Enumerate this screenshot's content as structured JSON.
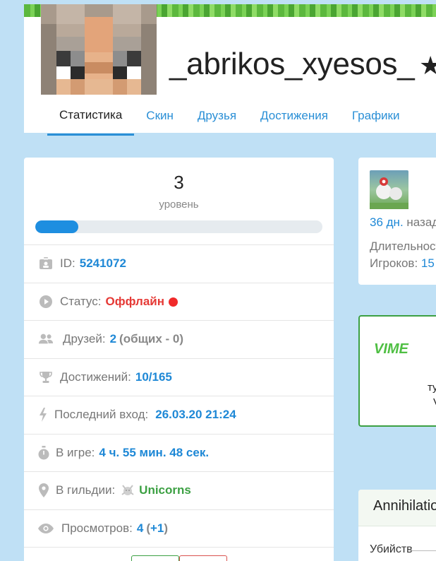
{
  "profile": {
    "username": "_abrikos_xyesos_",
    "star_icon": "star-icon"
  },
  "tabs": [
    {
      "label": "Статистика",
      "active": true
    },
    {
      "label": "Скин"
    },
    {
      "label": "Друзья"
    },
    {
      "label": "Достижения"
    },
    {
      "label": "Графики"
    }
  ],
  "stats": {
    "level": "3",
    "level_label": "уровень",
    "level_progress_percent": 15,
    "rows": {
      "id": {
        "label": "ID:",
        "value": "5241072",
        "icon": "id-card-icon"
      },
      "status": {
        "label": "Статус:",
        "value": "Оффлайн",
        "icon": "play-circle-icon"
      },
      "friends": {
        "label": "Друзей:",
        "value": "2",
        "extra": "(общих - 0)",
        "icon": "users-icon"
      },
      "achievements": {
        "label": "Достижений:",
        "value": "10/165",
        "icon": "trophy-icon"
      },
      "last_login": {
        "label": "Последний вход:",
        "value": "26.03.20 21:24",
        "icon": "bolt-icon"
      },
      "playtime": {
        "label": "В игре:",
        "value": "4 ч. 55 мин. 48 сек.",
        "icon": "stopwatch-icon"
      },
      "guild": {
        "label": "В гильдии:",
        "value": "Unicorns",
        "icon": "map-marker-icon"
      },
      "views": {
        "label": "Просмотров:",
        "value": "4",
        "open": "(",
        "extra": "+1",
        "close": ")",
        "icon": "eye-icon"
      }
    }
  },
  "last_game": {
    "ago_value": "36 дн.",
    "ago_suffix": "назад",
    "duration_label": "Длительность",
    "players_label": "Игроков:",
    "players_value": "15"
  },
  "vime_card": {
    "logo_text": "VIME",
    "line1": "ту",
    "line2": "V"
  },
  "annihilation": {
    "title": "Annihilation",
    "kills_label": "Убийств"
  },
  "colors": {
    "page_bg": "#bfe0f5",
    "accent_blue": "#1e88d6",
    "offline_red": "#e53935",
    "guild_green": "#3ca043"
  }
}
